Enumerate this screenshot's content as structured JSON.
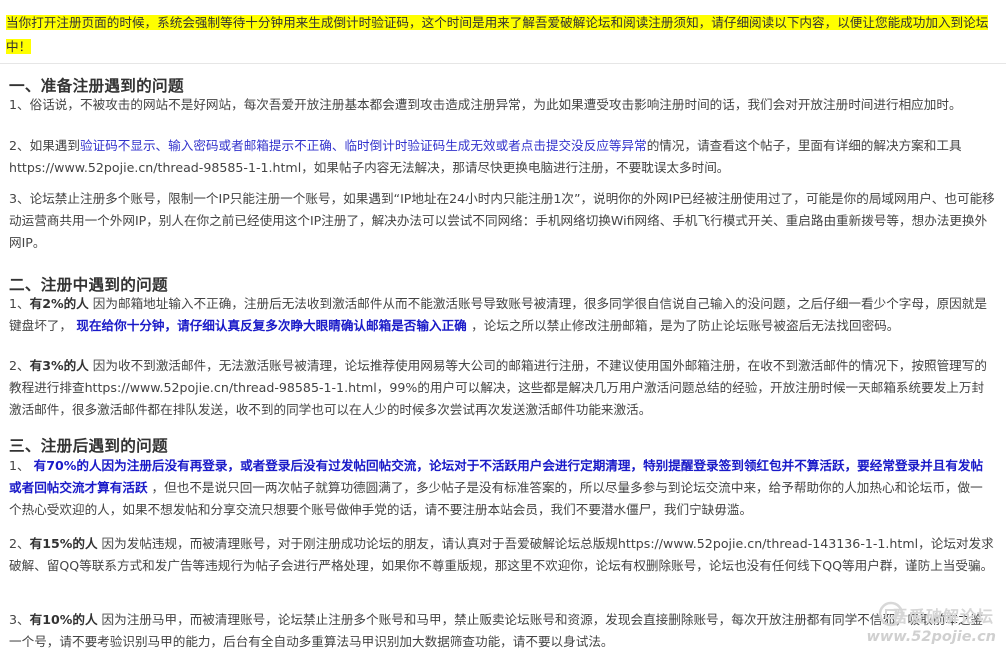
{
  "notice": "当你打开注册页面的时候，系统会强制等待十分钟用来生成倒计时验证码，这个时间是用来了解吾爱破解论坛和阅读注册须知，请仔细阅读以下内容，以便让您能成功加入到论坛中！",
  "sections": [
    {
      "title": "一、准备注册遇到的问题",
      "items": [
        {
          "p1": "1、俗话说，不被攻击的网站不是好网站，每次吾爱开放注册基本都会遭到攻击造成注册异常，为此如果遭受攻击影响注册时间的话，我们会对开放注册时间进行相应加时。"
        },
        {
          "p1": "2、如果遇到",
          "blue1": "验证码不显示、输入密码或者邮箱提示不正确、临时倒计时验证码生成无效或者点击提交没反应等异常",
          "p2": "的情况，请查看这个帖子，里面有详细的解决方案和工具",
          "url": "https://www.52pojie.cn/thread-98585-1-1.html",
          "p3": "，如果帖子内容无法解决，那请尽快更换电脑进行注册，不要耽误太多时间。"
        },
        {
          "p1": "3、论坛禁止注册多个账号，限制一个IP只能注册一个账号，如果遇到“IP地址在24小时内只能注册1次”，说明你的外网IP已经被注册使用过了，可能是你的局域网用户、也可能移动运营商共用一个外网IP，别人在你之前已经使用这个IP注册了，解决办法可以尝试不同网络：手机网络切换Wifi网络、手机飞行模式开关、重启路由重新拨号等，想办法更换外网IP。"
        }
      ]
    },
    {
      "title": "二、注册中遇到的问题",
      "items": [
        {
          "p1": "1、",
          "bold1": "有2%的人",
          "p2": " 因为邮箱地址输入不正确，注册后无法收到激活邮件从而不能激活账号导致账号被清理，很多同学很自信说自己输入的没问题，之后仔细一看少个字母，原因就是键盘坏了，",
          "blue1": " 现在给你十分钟，请仔细认真反复多次睁大眼睛确认邮箱是否输入正确 ",
          "p3": "，论坛之所以禁止修改注册邮箱，是为了防止论坛账号被盗后无法找回密码。"
        },
        {
          "p1": "2、",
          "bold1": "有3%的人",
          "p2": " 因为收不到激活邮件，无法激活账号被清理，论坛推荐使用网易等大公司的邮箱进行注册，不建议使用国外邮箱注册，在收不到激活邮件的情况下，按照管理写的教程进行排查",
          "url": "https://www.52pojie.cn/thread-98585-1-1.html",
          "p3": "，99%的用户可以解决，这些都是解决几万用户激活问题总结的经验，开放注册时候一天邮箱系统要发上万封激活邮件，很多激活邮件都在排队发送，收不到的同学也可以在人少的时候多次尝试再次发送激活邮件功能来激活。"
        }
      ]
    },
    {
      "title": "三、注册后遇到的问题",
      "items": [
        {
          "p1": "1、 ",
          "blue1": "有70%的人因为注册后没有再登录，或者登录后没有过发帖回帖交流，论坛对于不活跃用户会进行定期清理，特别提醒登录签到领红包并不算活跃，要经常登录并且有发帖或者回帖交流才算有活跃",
          "p2": " ，但也不是说只回一两次帖子就算功德圆满了，多少帖子是没有标准答案的，所以尽量多参与到论坛交流中来，给予帮助你的人加热心和论坛币，做一个热心受欢迎的人，如果不想发帖和分享交流只想要个账号做伸手党的话，请不要注册本站会员，我们不要潜水僵尸，我们宁缺毋滥。"
        },
        {
          "p1": "2、",
          "bold1": "有15%的人",
          "p2": " 因为发帖违规，而被清理账号，对于刚注册成功论坛的朋友，请认真对于吾爱破解论坛总版规",
          "url": "https://www.52pojie.cn/thread-143136-1-1.html",
          "p3": "，论坛对发求破解、留QQ等联系方式和发广告等违规行为帖子会进行严格处理，如果你不尊重版规，那这里不欢迎你，论坛有权删除账号，论坛也没有任何线下QQ等用户群，谨防上当受骗。"
        },
        {
          "p1": "3、",
          "bold1": "有10%的人",
          "p2": " 因为注册马甲，而被清理账号，论坛禁止注册多个账号和马甲，禁止贩卖论坛账号和资源，发现会直接删除账号，每次开放注册都有同学不信邪，吸取前车之鉴一个号，请不要考验识别马甲的能力，后台有全自动多重算法马甲识别加大数据筛查功能，请不要以身试法。"
        }
      ]
    }
  ],
  "watermark": {
    "name": "吾爱破解论坛",
    "url": "www.52pojie.cn"
  }
}
